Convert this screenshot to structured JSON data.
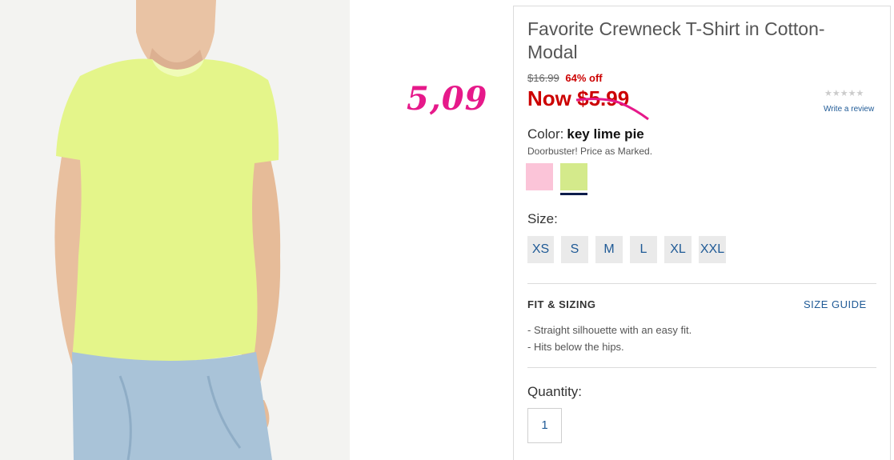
{
  "annotation": "5,09",
  "product": {
    "title": "Favorite Crewneck T-Shirt in Cotton-Modal",
    "original_price": "$16.99",
    "discount": "64% off",
    "now_prefix": "Now",
    "now_price": "$5.99",
    "rating_stars": "★★★★★",
    "review_link": "Write a review"
  },
  "color": {
    "label": "Color:",
    "name": "key lime pie",
    "note": "Doorbuster! Price as Marked.",
    "swatches": [
      "#fbc4d8",
      "#d4ea8b"
    ],
    "selected_index": 1
  },
  "size": {
    "label": "Size:",
    "options": [
      "XS",
      "S",
      "M",
      "L",
      "XL",
      "XXL"
    ]
  },
  "fit": {
    "heading": "FIT & SIZING",
    "guide_link": "SIZE GUIDE",
    "items": [
      "-  Straight silhouette with an easy fit.",
      "-  Hits below the hips."
    ]
  },
  "quantity": {
    "label": "Quantity:",
    "value": "1"
  },
  "colors": {
    "accent_red": "#cc0000",
    "link_blue": "#1f5a96",
    "annotation_pink": "#e6198a"
  }
}
